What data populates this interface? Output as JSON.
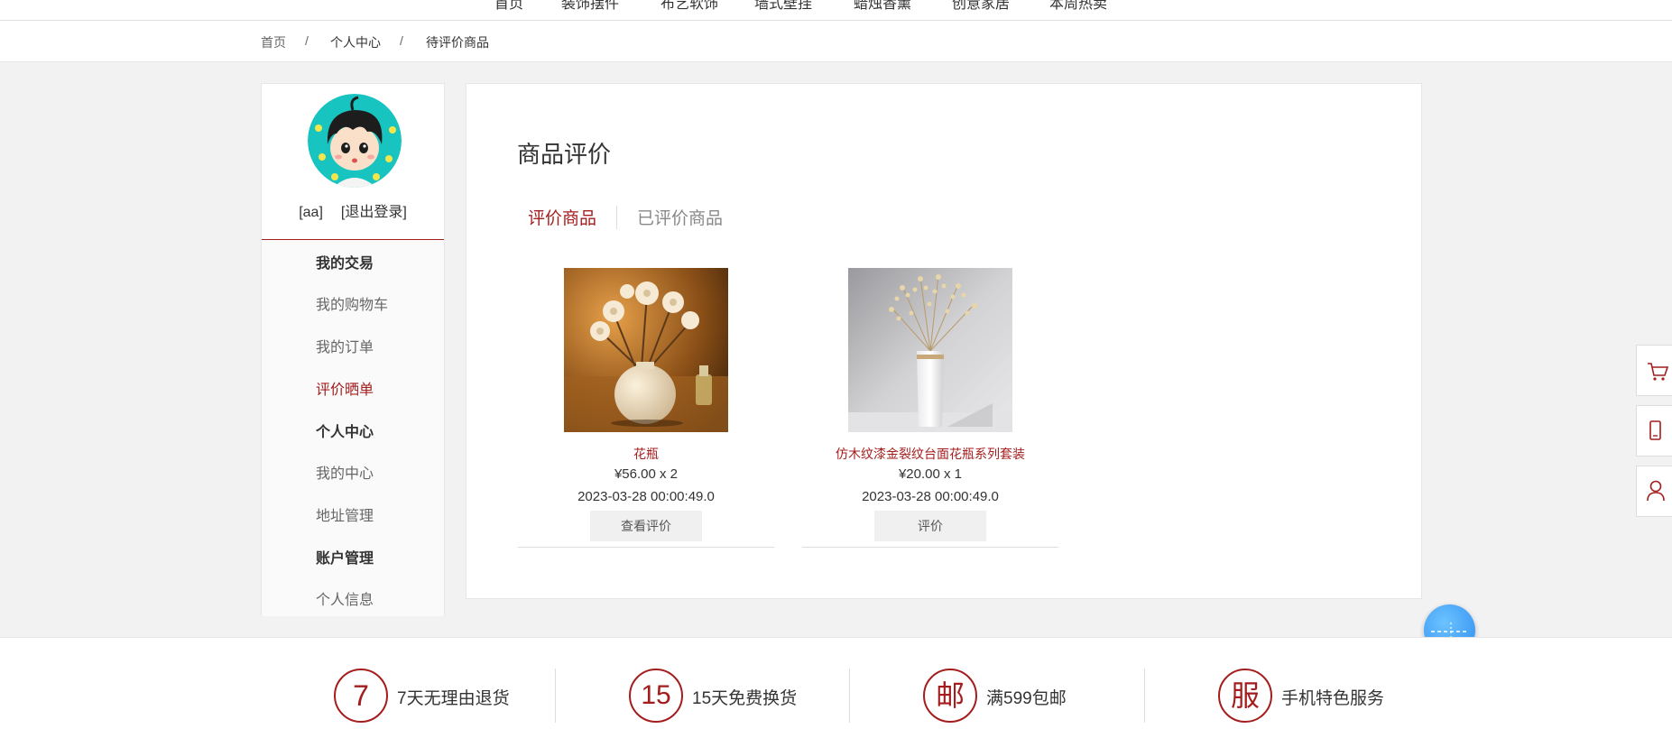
{
  "top_nav": {
    "items": [
      "首页",
      "装饰摆件",
      "布艺软饰",
      "墙式壁挂",
      "蜡烛香薰",
      "创意家居",
      "本周热卖"
    ]
  },
  "breadcrumb": {
    "home": "首页",
    "sep": "/",
    "center": "个人中心",
    "current": "待评价商品"
  },
  "user": {
    "name": "[aa]",
    "logout": "[退出登录]"
  },
  "sidebar": {
    "trade_title": "我的交易",
    "cart": "我的购物车",
    "orders": "我的订单",
    "reviews": "评价晒单",
    "center_title": "个人中心",
    "my_center": "我的中心",
    "address": "地址管理",
    "account_title": "账户管理",
    "profile": "个人信息"
  },
  "main": {
    "title": "商品评价",
    "tabs": [
      "评价商品",
      "已评价商品"
    ],
    "products": [
      {
        "name": "花瓶",
        "price": "¥56.00 x 2",
        "date": "2023-03-28 00:00:49.0",
        "button": "查看评价"
      },
      {
        "name": "仿木纹漆金裂纹台面花瓶系列套装",
        "price": "¥20.00 x 1",
        "date": "2023-03-28 00:00:49.0",
        "button": "评价"
      }
    ]
  },
  "footer": {
    "services": [
      {
        "icon_char": "7",
        "label": "7天无理由退货"
      },
      {
        "icon_char": "15",
        "label": "15天免费换货"
      },
      {
        "icon_char": "邮",
        "label": "满599包邮"
      },
      {
        "icon_char": "服",
        "label": "手机特色服务"
      }
    ]
  },
  "colors": {
    "accent": "#a41d1d",
    "assistant": "#2f8bf0"
  },
  "icons": [
    "cart-icon",
    "mobile-icon",
    "user-icon",
    "assistant-icon"
  ]
}
